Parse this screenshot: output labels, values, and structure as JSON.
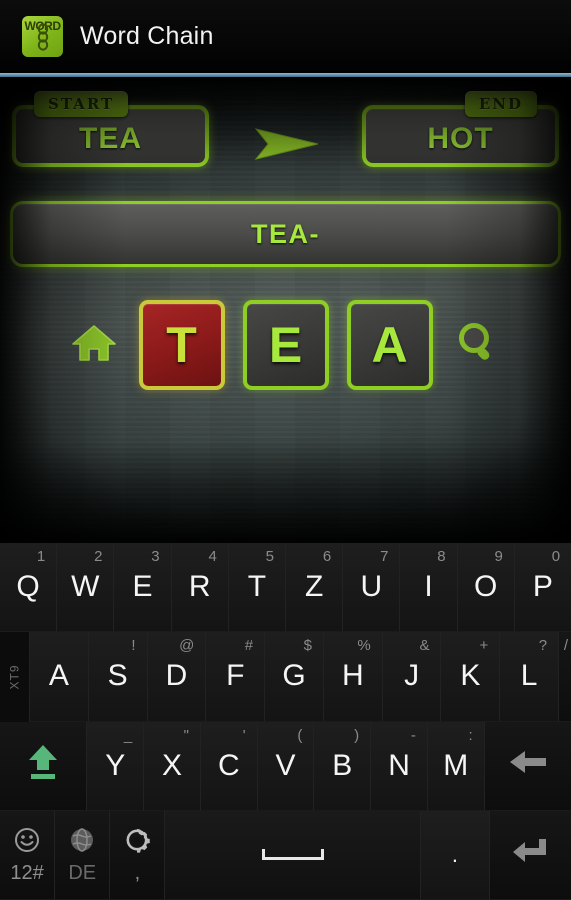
{
  "header": {
    "title": "Word Chain",
    "logo_text": "WORD",
    "logo_icon": "chain-link-icon"
  },
  "board": {
    "start_panel": {
      "tab_label": "START",
      "word": "TEA"
    },
    "end_panel": {
      "tab_label": "END",
      "word": "HOT"
    },
    "arrow_icon": "arrow-right-icon",
    "chain_bar": {
      "text": "TEA-"
    },
    "home_icon": "home-icon",
    "search_icon": "magnifier-icon",
    "tiles": [
      {
        "letter": "T",
        "state": "active"
      },
      {
        "letter": "E",
        "state": "normal"
      },
      {
        "letter": "A",
        "state": "normal"
      }
    ]
  },
  "colors": {
    "accent_green": "#8fce22",
    "text_green": "#a6e83c",
    "active_tile_red": "#8d1a1a",
    "header_rule_blue": "#5d8fae",
    "board_bg": "#46514f"
  },
  "keyboard": {
    "xt9_label": "XT9",
    "row1": [
      {
        "key": "Q",
        "alt": "1"
      },
      {
        "key": "W",
        "alt": "2"
      },
      {
        "key": "E",
        "alt": "3"
      },
      {
        "key": "R",
        "alt": "4"
      },
      {
        "key": "T",
        "alt": "5"
      },
      {
        "key": "Z",
        "alt": "6"
      },
      {
        "key": "U",
        "alt": "7"
      },
      {
        "key": "I",
        "alt": "8"
      },
      {
        "key": "O",
        "alt": "9"
      },
      {
        "key": "P",
        "alt": "0"
      }
    ],
    "row2": [
      {
        "key": "A",
        "alt": ""
      },
      {
        "key": "S",
        "alt": "!"
      },
      {
        "key": "D",
        "alt": "@"
      },
      {
        "key": "F",
        "alt": "#"
      },
      {
        "key": "G",
        "alt": "$"
      },
      {
        "key": "H",
        "alt": "%"
      },
      {
        "key": "J",
        "alt": "&"
      },
      {
        "key": "K",
        "alt": "+"
      },
      {
        "key": "L",
        "alt": "?"
      }
    ],
    "row2_trailing_alt": "/",
    "row3": [
      {
        "key": "Y",
        "alt": "_"
      },
      {
        "key": "X",
        "alt": "\""
      },
      {
        "key": "C",
        "alt": "'"
      },
      {
        "key": "V",
        "alt": "("
      },
      {
        "key": "B",
        "alt": ")"
      },
      {
        "key": "N",
        "alt": "-"
      },
      {
        "key": "M",
        "alt": ":"
      }
    ],
    "shift_icon": "shift-up-arrow-icon",
    "backspace_icon": "backspace-arrow-icon",
    "row4": {
      "emoji_icon": "smiley-icon",
      "emoji_label": "12#",
      "language_icon": "globe-icon",
      "language_label": "DE",
      "settings_icon": "gear-icon",
      "settings_label": ",",
      "space_label": "",
      "period_label": ".",
      "enter_icon": "enter-arrow-icon"
    }
  }
}
